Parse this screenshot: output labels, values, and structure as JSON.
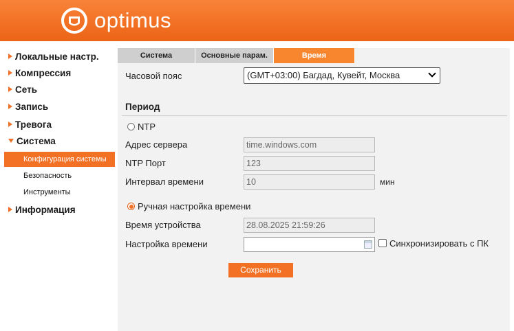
{
  "brand": {
    "name": "optimus",
    "accent": "#f27124"
  },
  "sidebar": {
    "items": [
      {
        "label": "Локальные настр.",
        "expanded": false
      },
      {
        "label": "Компрессия",
        "expanded": false
      },
      {
        "label": "Сеть",
        "expanded": false
      },
      {
        "label": "Запись",
        "expanded": false
      },
      {
        "label": "Тревога",
        "expanded": false
      },
      {
        "label": "Система",
        "expanded": true,
        "children": [
          {
            "label": "Конфигурация системы",
            "active": true
          },
          {
            "label": "Безопасность",
            "active": false
          },
          {
            "label": "Инструменты",
            "active": false
          }
        ]
      },
      {
        "label": "Информация",
        "expanded": false
      }
    ]
  },
  "tabs": [
    {
      "label": "Система",
      "active": false
    },
    {
      "label": "Основные парам.",
      "active": false
    },
    {
      "label": "Время",
      "active": true
    }
  ],
  "form": {
    "timezone_label": "Часовой пояс",
    "timezone_value": "(GMT+03:00) Багдад, Кувейт, Москва",
    "period_heading": "Период",
    "ntp": {
      "label": "NTP",
      "selected": false,
      "server_label": "Адрес сервера",
      "server_value": "time.windows.com",
      "port_label": "NTP Порт",
      "port_value": "123",
      "interval_label": "Интервал времени",
      "interval_value": "10",
      "interval_unit": "мин"
    },
    "manual": {
      "label": "Ручная настройка времени",
      "selected": true,
      "device_time_label": "Время устройства",
      "device_time_value": "28.08.2025 21:59:26",
      "set_time_label": "Настройка времени",
      "set_time_value": "",
      "sync_pc_label": "Синхронизировать с ПК",
      "sync_pc_checked": false
    },
    "save_label": "Сохранить"
  }
}
